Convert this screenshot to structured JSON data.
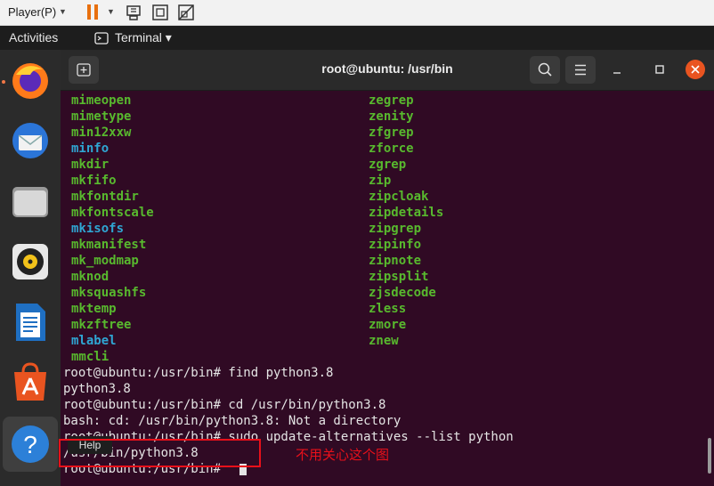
{
  "vmware": {
    "menu_label": "Player(P)",
    "icons": [
      "dropdown-caret-icon",
      "pause-icon",
      "send-ctrl-alt-del-icon",
      "fit-window-icon",
      "unity-icon"
    ]
  },
  "topbar": {
    "activities": "Activities",
    "app_name": "Terminal ▾"
  },
  "dock": {
    "items": [
      "firefox-icon",
      "thunderbird-icon",
      "files-icon",
      "rhythmbox-icon",
      "writer-icon",
      "software-icon",
      "help-icon"
    ]
  },
  "terminal": {
    "title": "root@ubuntu: /usr/bin",
    "left_column": [
      {
        "text": "mimeopen",
        "color": "green"
      },
      {
        "text": "mimetype",
        "color": "green"
      },
      {
        "text": "min12xxw",
        "color": "green"
      },
      {
        "text": "minfo",
        "color": "cyan"
      },
      {
        "text": "mkdir",
        "color": "green"
      },
      {
        "text": "mkfifo",
        "color": "green"
      },
      {
        "text": "mkfontdir",
        "color": "green"
      },
      {
        "text": "mkfontscale",
        "color": "green"
      },
      {
        "text": "mkisofs",
        "color": "cyan"
      },
      {
        "text": "mkmanifest",
        "color": "green"
      },
      {
        "text": "mk_modmap",
        "color": "green"
      },
      {
        "text": "mknod",
        "color": "green"
      },
      {
        "text": "mksquashfs",
        "color": "green"
      },
      {
        "text": "mktemp",
        "color": "green"
      },
      {
        "text": "mkzftree",
        "color": "green"
      },
      {
        "text": "mlabel",
        "color": "cyan"
      },
      {
        "text": "mmcli",
        "color": "green"
      }
    ],
    "right_column": [
      {
        "text": "zegrep",
        "color": "green"
      },
      {
        "text": "zenity",
        "color": "green"
      },
      {
        "text": "zfgrep",
        "color": "green"
      },
      {
        "text": "zforce",
        "color": "green"
      },
      {
        "text": "zgrep",
        "color": "green"
      },
      {
        "text": "zip",
        "color": "green"
      },
      {
        "text": "zipcloak",
        "color": "green"
      },
      {
        "text": "zipdetails",
        "color": "green"
      },
      {
        "text": "zipgrep",
        "color": "green"
      },
      {
        "text": "zipinfo",
        "color": "green"
      },
      {
        "text": "zipnote",
        "color": "green"
      },
      {
        "text": "zipsplit",
        "color": "green"
      },
      {
        "text": "zjsdecode",
        "color": "green"
      },
      {
        "text": "zless",
        "color": "green"
      },
      {
        "text": "zmore",
        "color": "green"
      },
      {
        "text": "znew",
        "color": "green"
      }
    ],
    "output_lines": [
      "root@ubuntu:/usr/bin# find python3.8",
      "python3.8",
      "root@ubuntu:/usr/bin# cd /usr/bin/python3.8",
      "bash: cd: /usr/bin/python3.8: Not a directory",
      "root@ubuntu:/usr/bin# sudo update-alternatives --list python",
      "/usr/bin/python3.8",
      "root@ubuntu:/usr/bin# "
    ],
    "line5_prefix": "r",
    "line5_partial": "  buntu:/usr/bin# sudo update-alternatives --list python",
    "line6_tail": "bin/python3.8"
  },
  "tooltip": {
    "text": "Help"
  },
  "annotation": {
    "text": "不用关心这个图",
    "color": "#e8101a"
  },
  "colors": {
    "terminal_bg": "#300a24",
    "green": "#58b92e",
    "cyan": "#2fa6d3",
    "close": "#e95420"
  }
}
